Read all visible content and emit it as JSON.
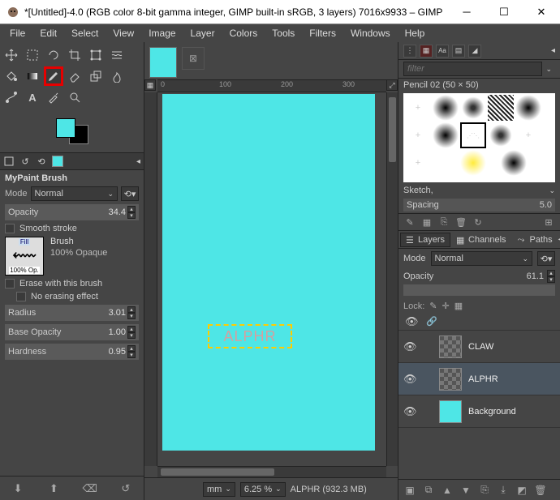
{
  "window": {
    "title": "*[Untitled]-4.0 (RGB color 8-bit gamma integer, GIMP built-in sRGB, 3 layers) 7016x9933 – GIMP"
  },
  "menu": [
    "File",
    "Edit",
    "Select",
    "View",
    "Image",
    "Layer",
    "Colors",
    "Tools",
    "Filters",
    "Windows",
    "Help"
  ],
  "tool_options": {
    "title": "MyPaint Brush",
    "mode_label": "Mode",
    "mode_value": "Normal",
    "opacity_label": "Opacity",
    "opacity_value": "34.4",
    "smooth_label": "Smooth stroke",
    "brush_label": "Brush",
    "brush_fill": "Fill",
    "brush_op": "100% Op.",
    "brush_name": "100% Opaque",
    "erase_label": "Erase with this brush",
    "noerase_label": "No erasing effect",
    "radius_label": "Radius",
    "radius_value": "3.01",
    "baseop_label": "Base Opacity",
    "baseop_value": "1.00",
    "hardness_label": "Hardness",
    "hardness_value": "0.95"
  },
  "ruler": {
    "t0": "0",
    "t1": "100",
    "t2": "200",
    "t3": "300"
  },
  "canvas_text": "ALPHR",
  "statusbar": {
    "unit": "mm",
    "zoom": "6.25 %",
    "info": "ALPHR (932.3 MB)"
  },
  "right": {
    "filter_placeholder": "filter",
    "brush_name": "Pencil 02 (50 × 50)",
    "sketch_label": "Sketch,",
    "spacing_label": "Spacing",
    "spacing_value": "5.0",
    "tabs": {
      "layers": "Layers",
      "channels": "Channels",
      "paths": "Paths"
    },
    "mode_label": "Mode",
    "mode_value": "Normal",
    "opacity_label": "Opacity",
    "opacity_value": "61.1",
    "lock_label": "Lock:",
    "layers": [
      {
        "name": "CLAW",
        "visible": true,
        "thumb": "check"
      },
      {
        "name": "ALPHR",
        "visible": true,
        "thumb": "check",
        "selected": true
      },
      {
        "name": "Background",
        "visible": true,
        "thumb": "cyan"
      }
    ]
  }
}
